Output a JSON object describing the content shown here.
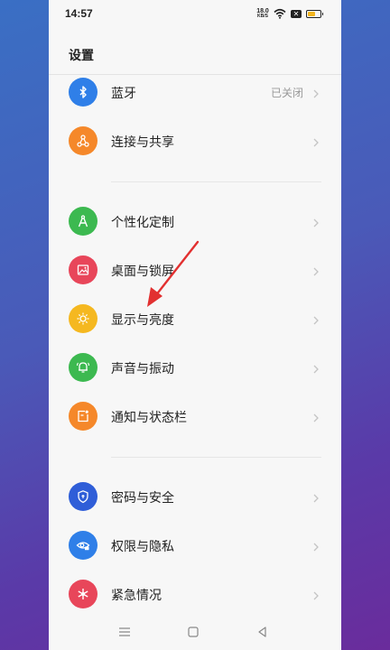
{
  "status_bar": {
    "time": "14:57",
    "net_speed_top": "18.0",
    "net_speed_bottom": "KB/S",
    "sim": "✕",
    "battery_level": 0.7
  },
  "page": {
    "title": "设置"
  },
  "groups": [
    [
      {
        "label": "蓝牙",
        "value": "已关闭",
        "icon": "bluetooth-icon",
        "color": "#2f7fe8"
      },
      {
        "label": "连接与共享",
        "value": "",
        "icon": "share-nodes-icon",
        "color": "#f5882a"
      }
    ],
    [
      {
        "label": "个性化定制",
        "value": "",
        "icon": "compass-icon",
        "color": "#3cb950"
      },
      {
        "label": "桌面与锁屏",
        "value": "",
        "icon": "picture-icon",
        "color": "#e8465a"
      },
      {
        "label": "显示与亮度",
        "value": "",
        "icon": "sun-icon",
        "color": "#f5b820"
      },
      {
        "label": "声音与振动",
        "value": "",
        "icon": "bell-icon",
        "color": "#3cb950"
      },
      {
        "label": "通知与状态栏",
        "value": "",
        "icon": "notification-icon",
        "color": "#f5882a"
      }
    ],
    [
      {
        "label": "密码与安全",
        "value": "",
        "icon": "shield-icon",
        "color": "#2f5ed8"
      },
      {
        "label": "权限与隐私",
        "value": "",
        "icon": "eye-lock-icon",
        "color": "#2f7fe8"
      },
      {
        "label": "紧急情况",
        "value": "",
        "icon": "snowflake-icon",
        "color": "#e8465a"
      }
    ]
  ]
}
